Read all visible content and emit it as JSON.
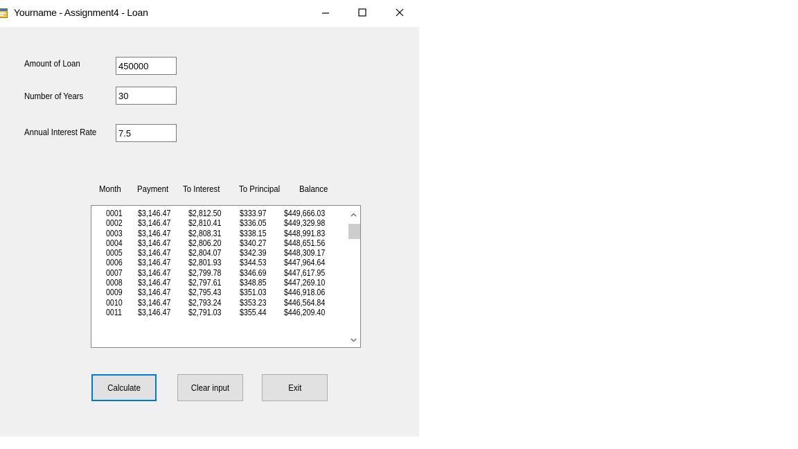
{
  "window": {
    "title": "Yourname - Assignment4 - Loan"
  },
  "form": {
    "amount_label": "Amount of Loan",
    "amount_value": "450000",
    "years_label": "Number of Years",
    "years_value": "30",
    "rate_label": "Annual Interest Rate",
    "rate_value": "7.5"
  },
  "table": {
    "headers": [
      "Month",
      "Payment",
      "To Interest",
      "To Principal",
      "Balance"
    ],
    "rows": [
      [
        "0001",
        "$3,146.47",
        "$2,812.50",
        "$333.97",
        "$449,666.03"
      ],
      [
        "0002",
        "$3,146.47",
        "$2,810.41",
        "$336.05",
        "$449,329.98"
      ],
      [
        "0003",
        "$3,146.47",
        "$2,808.31",
        "$338.15",
        "$448,991.83"
      ],
      [
        "0004",
        "$3,146.47",
        "$2,806.20",
        "$340.27",
        "$448,651.56"
      ],
      [
        "0005",
        "$3,146.47",
        "$2,804.07",
        "$342.39",
        "$448,309.17"
      ],
      [
        "0006",
        "$3,146.47",
        "$2,801.93",
        "$344.53",
        "$447,964.64"
      ],
      [
        "0007",
        "$3,146.47",
        "$2,799.78",
        "$346.69",
        "$447,617.95"
      ],
      [
        "0008",
        "$3,146.47",
        "$2,797.61",
        "$348.85",
        "$447,269.10"
      ],
      [
        "0009",
        "$3,146.47",
        "$2,795.43",
        "$351.03",
        "$446,918.06"
      ],
      [
        "0010",
        "$3,146.47",
        "$2,793.24",
        "$353.23",
        "$446,564.84"
      ],
      [
        "0011",
        "$3,146.47",
        "$2,791.03",
        "$355.44",
        "$446,209.40"
      ]
    ]
  },
  "buttons": {
    "calculate": "Calculate",
    "clear": "Clear input",
    "exit": "Exit"
  },
  "icons": {
    "app": "app-form-icon",
    "minimize": "minimize-icon",
    "maximize": "maximize-icon",
    "close": "close-icon",
    "scroll_up": "chevron-up-icon",
    "scroll_down": "chevron-down-icon"
  },
  "colors": {
    "focus_border": "#0078d7",
    "window_bg": "#f0f0f0"
  }
}
